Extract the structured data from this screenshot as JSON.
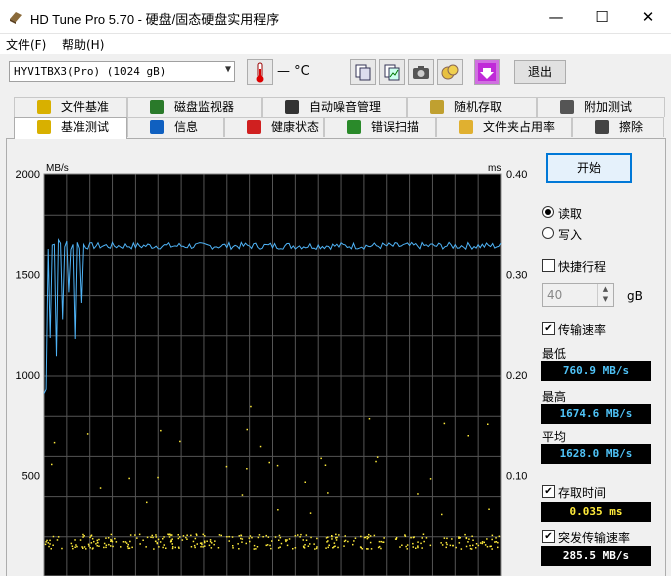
{
  "window": {
    "title": "HD Tune Pro 5.70 - 硬盘/固态硬盘实用程序",
    "minimize": "—",
    "maximize": "☐",
    "close": "✕"
  },
  "menu": {
    "file": "文件(F)",
    "help": "帮助(H)"
  },
  "toolbar": {
    "drive": "HYV1TBX3(Pro) (1024 gB)",
    "temperature": "— °C",
    "exit": "退出"
  },
  "tabs_row1": [
    "文件基准",
    "磁盘监视器",
    "自动噪音管理",
    "随机存取",
    "附加测试"
  ],
  "tabs_row2": [
    "基准测试",
    "信息",
    "健康状态",
    "错误扫描",
    "文件夹占用率",
    "擦除"
  ],
  "active_tab": "基准测试",
  "controls": {
    "start": "开始",
    "read": "读取",
    "write": "写入",
    "read_selected": true,
    "quick_stroke": "快捷行程",
    "quick_stroke_checked": false,
    "quick_value": "40",
    "quick_unit": "gB",
    "transfer_rate": "传输速率",
    "transfer_rate_checked": true,
    "min_label": "最低",
    "min_value": "760.9 MB/s",
    "max_label": "最高",
    "max_value": "1674.6 MB/s",
    "avg_label": "平均",
    "avg_value": "1628.0 MB/s",
    "access_time": "存取时间",
    "access_time_checked": true,
    "access_value": "0.035 ms",
    "burst": "突发传输速率",
    "burst_checked": true,
    "burst_value": "285.5 MB/s"
  },
  "chart_data": {
    "type": "line",
    "y_left_label": "MB/s",
    "y_right_label": "ms",
    "y_left_ticks": [
      "2000",
      "1500",
      "1000",
      "500"
    ],
    "y_right_ticks": [
      "0.40",
      "0.30",
      "0.20",
      "0.10"
    ],
    "ylim_left": [
      0,
      2000
    ],
    "ylim_right": [
      0,
      0.4
    ],
    "grid": true,
    "series": [
      {
        "name": "传输速率",
        "color": "#4fb3f6",
        "steady_mbs": 1650,
        "min_mbs": 760.9,
        "max_mbs": 1674.6,
        "avg_mbs": 1628.0
      },
      {
        "name": "存取时间",
        "color": "#ffeb3b",
        "avg_ms": 0.035
      }
    ]
  }
}
